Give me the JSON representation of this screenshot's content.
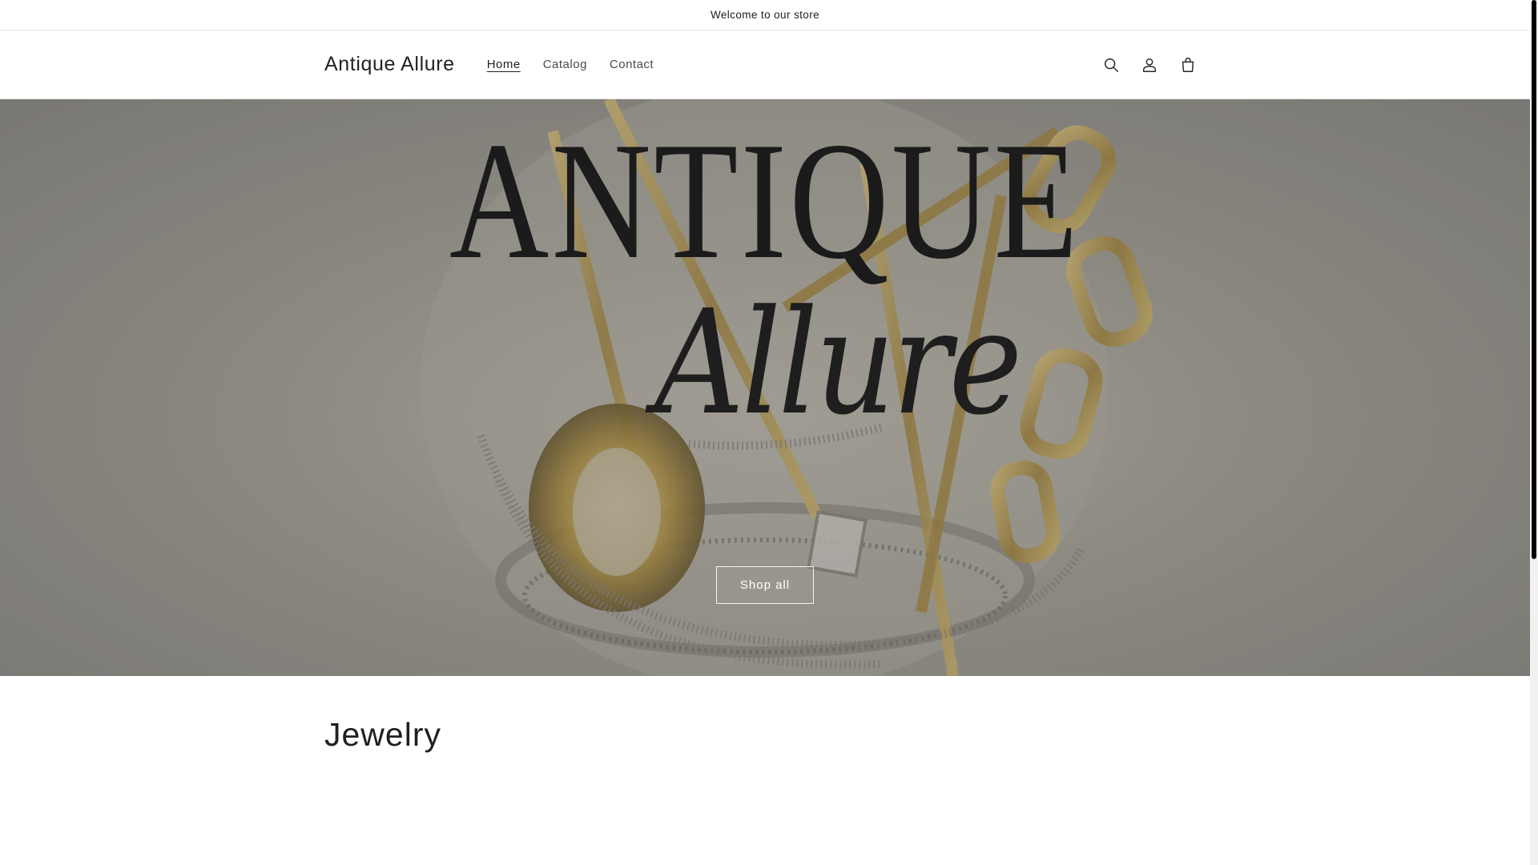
{
  "announcement": {
    "text": "Welcome to our store"
  },
  "header": {
    "logo": "Antique Allure",
    "nav": [
      {
        "label": "Home",
        "active": true
      },
      {
        "label": "Catalog",
        "active": false
      },
      {
        "label": "Contact",
        "active": false
      }
    ],
    "icons": [
      "search-icon",
      "account-icon",
      "cart-icon"
    ]
  },
  "hero": {
    "title": "ANTIQUE",
    "subtitle": "Allure",
    "button_label": "Shop all"
  },
  "section": {
    "heading": "Jewelry"
  },
  "colors": {
    "text": "#121212",
    "border": "#e6e6e6",
    "hero_overlay": "#464646",
    "gold": "#b89a4a"
  }
}
